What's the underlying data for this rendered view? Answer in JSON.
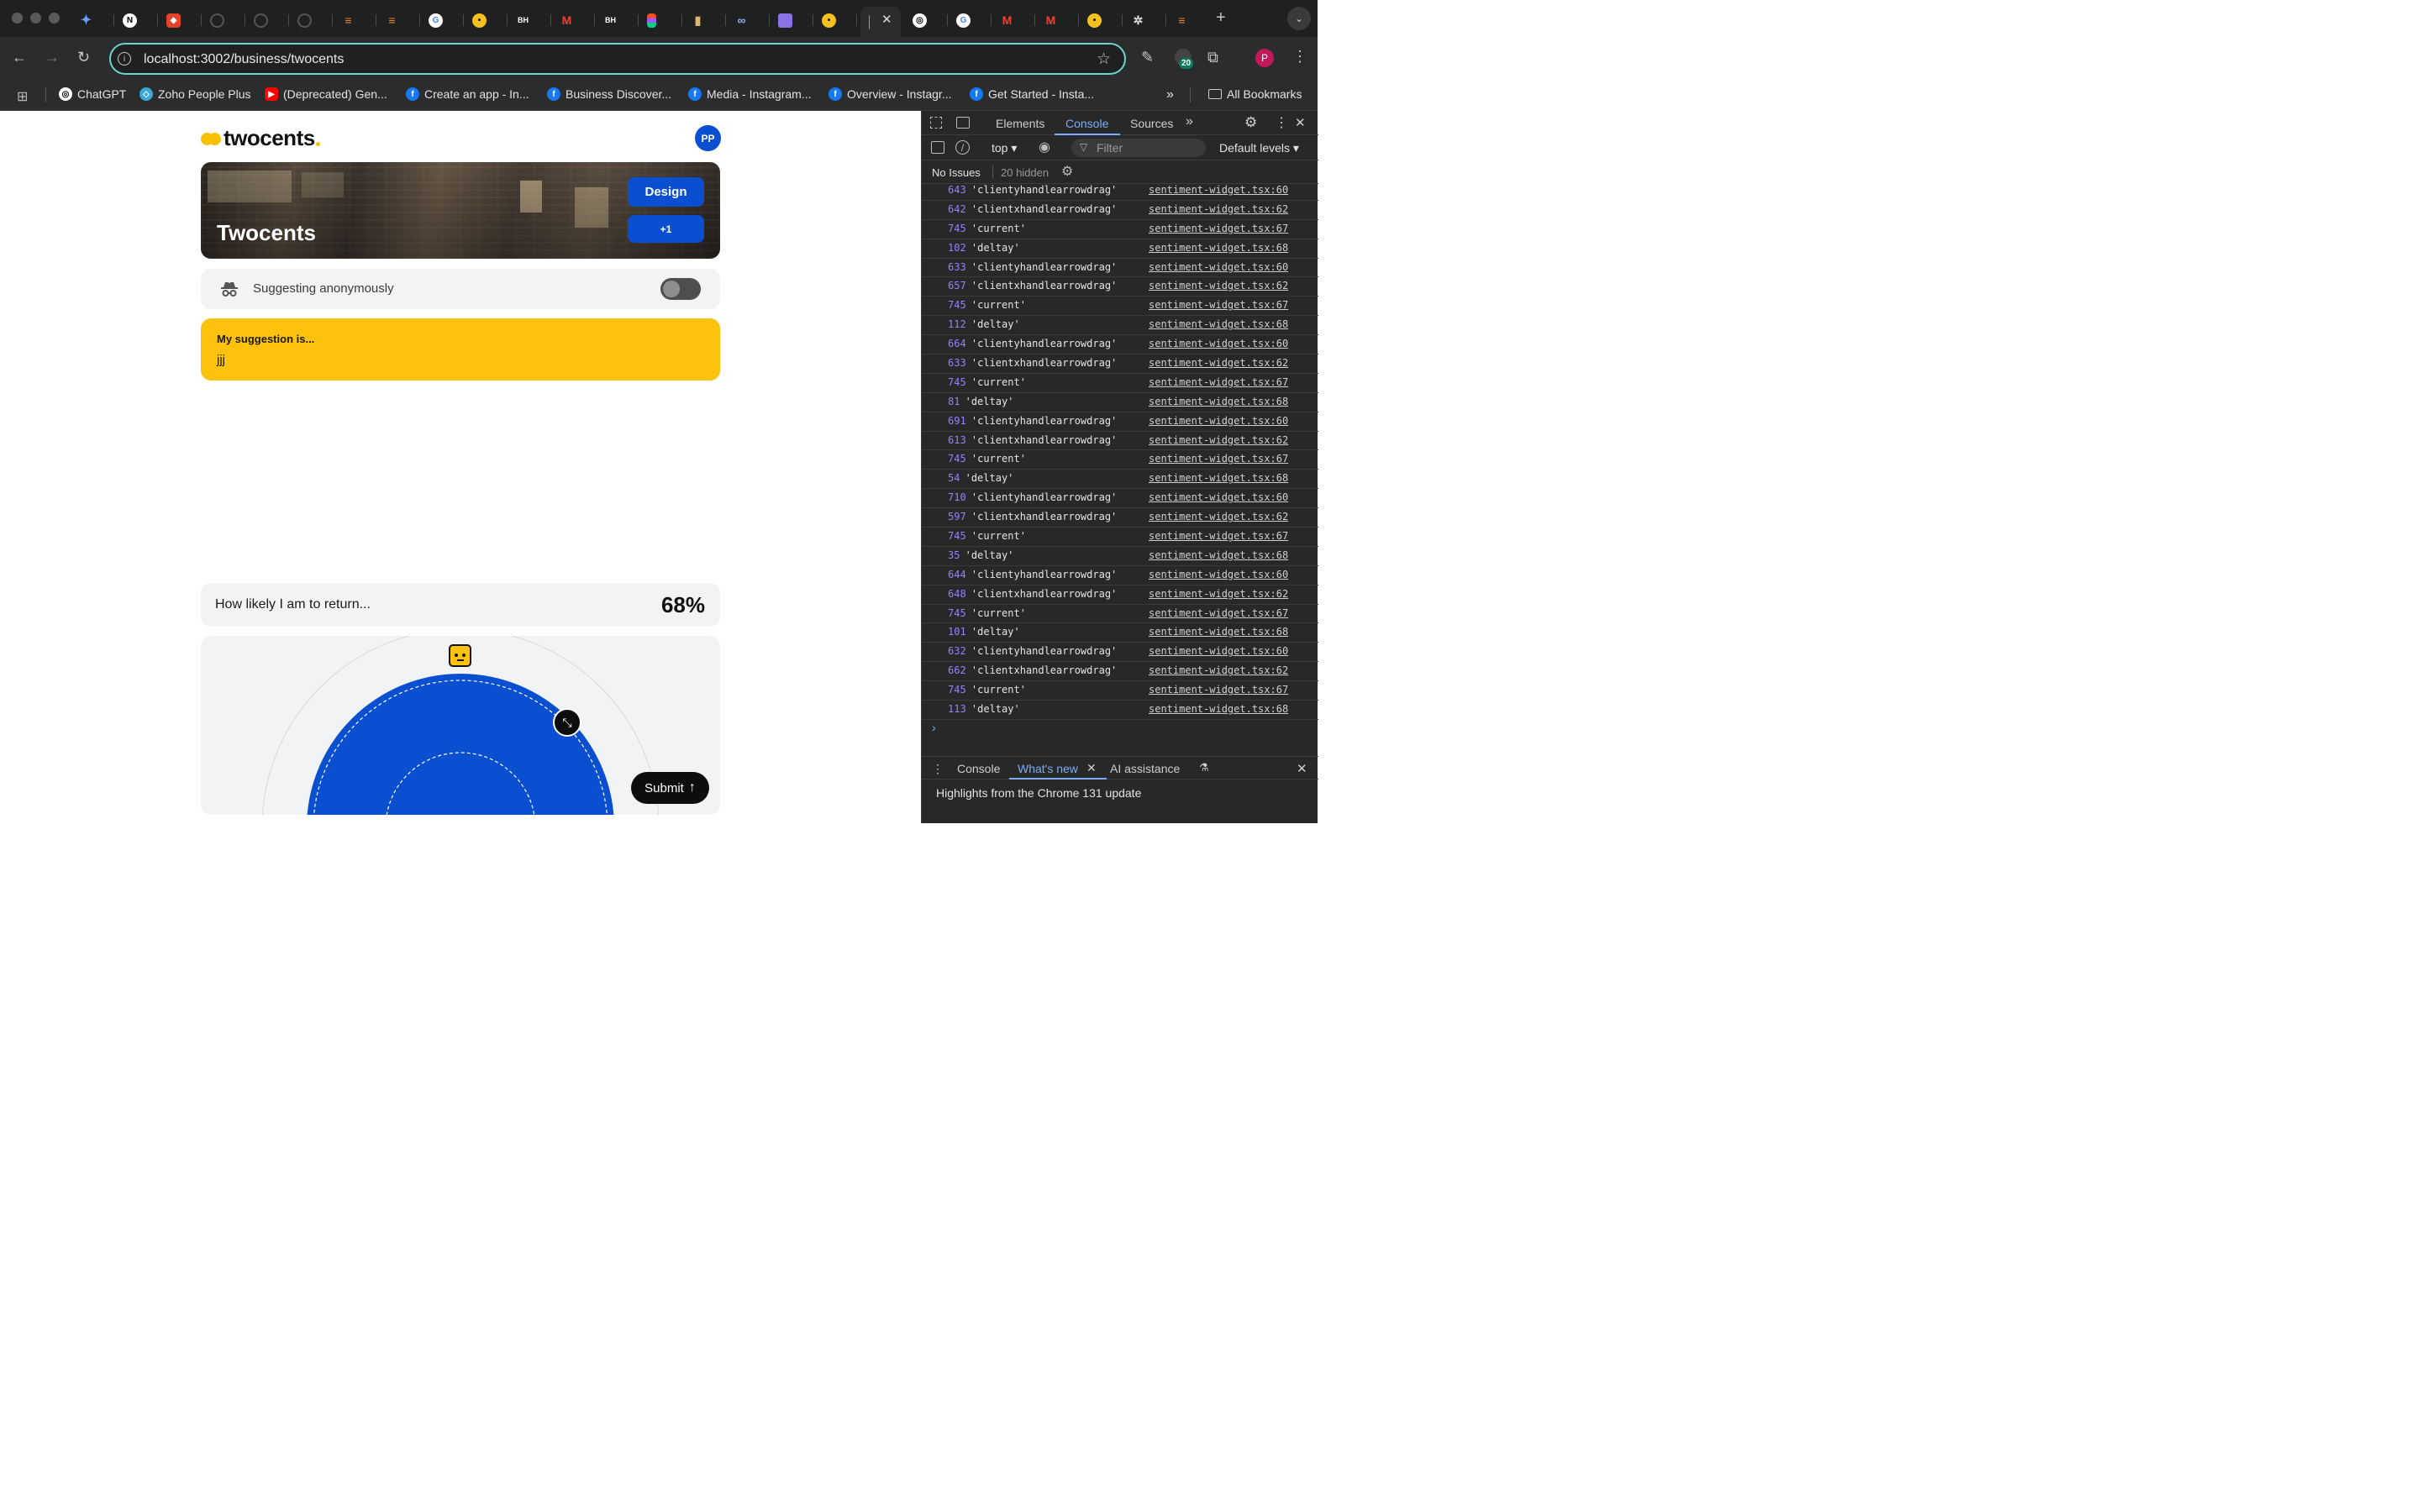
{
  "browser": {
    "url": "localhost:3002/business/twocents",
    "extension_badge": "20",
    "profile_initial": "P",
    "bookmarks": [
      {
        "label": "ChatGPT",
        "icon": "chatgpt-icon"
      },
      {
        "label": "Zoho People Plus",
        "icon": "zoho-icon"
      },
      {
        "label": "(Deprecated) Gen...",
        "icon": "youtube-icon"
      },
      {
        "label": "Create an app - In...",
        "icon": "facebook-icon"
      },
      {
        "label": "Business Discover...",
        "icon": "facebook-icon"
      },
      {
        "label": "Media - Instagram...",
        "icon": "facebook-icon"
      },
      {
        "label": "Overview - Instagr...",
        "icon": "facebook-icon"
      },
      {
        "label": "Get Started - Insta...",
        "icon": "facebook-icon"
      }
    ],
    "all_bookmarks": "All Bookmarks",
    "overflow": "»"
  },
  "page": {
    "logo_text": "twocents",
    "avatar_initials": "PP",
    "hero_title": "Twocents",
    "hero_tags": [
      "Design",
      "+1"
    ],
    "anonymous_label": "Suggesting anonymously",
    "anonymous_on": false,
    "suggestion_label": "My suggestion is...",
    "suggestion_value": "jjj",
    "likely_label": "How likely I am to return...",
    "likely_percent": "68%",
    "submit_label": "Submit",
    "colors": {
      "brand_yellow": "#fcc20d",
      "brand_blue": "#0a4fcf"
    }
  },
  "devtools": {
    "tabs": [
      "Elements",
      "Console",
      "Sources"
    ],
    "active_tab": "Console",
    "context": "top",
    "filter_placeholder": "Filter",
    "levels": "Default levels",
    "issues": "No Issues",
    "hidden": "20 hidden",
    "logs": [
      {
        "num": "643",
        "text": "'clientyhandlearrowdrag'",
        "src": "sentiment-widget.tsx:60"
      },
      {
        "num": "642",
        "text": "'clientxhandlearrowdrag'",
        "src": "sentiment-widget.tsx:62"
      },
      {
        "num": "745",
        "text": "'current'",
        "src": "sentiment-widget.tsx:67"
      },
      {
        "num": "102",
        "text": "'deltay'",
        "src": "sentiment-widget.tsx:68"
      },
      {
        "num": "633",
        "text": "'clientyhandlearrowdrag'",
        "src": "sentiment-widget.tsx:60"
      },
      {
        "num": "657",
        "text": "'clientxhandlearrowdrag'",
        "src": "sentiment-widget.tsx:62"
      },
      {
        "num": "745",
        "text": "'current'",
        "src": "sentiment-widget.tsx:67"
      },
      {
        "num": "112",
        "text": "'deltay'",
        "src": "sentiment-widget.tsx:68"
      },
      {
        "num": "664",
        "text": "'clientyhandlearrowdrag'",
        "src": "sentiment-widget.tsx:60"
      },
      {
        "num": "633",
        "text": "'clientxhandlearrowdrag'",
        "src": "sentiment-widget.tsx:62"
      },
      {
        "num": "745",
        "text": "'current'",
        "src": "sentiment-widget.tsx:67"
      },
      {
        "num": "81",
        "text": "'deltay'",
        "src": "sentiment-widget.tsx:68"
      },
      {
        "num": "691",
        "text": "'clientyhandlearrowdrag'",
        "src": "sentiment-widget.tsx:60"
      },
      {
        "num": "613",
        "text": "'clientxhandlearrowdrag'",
        "src": "sentiment-widget.tsx:62"
      },
      {
        "num": "745",
        "text": "'current'",
        "src": "sentiment-widget.tsx:67"
      },
      {
        "num": "54",
        "text": "'deltay'",
        "src": "sentiment-widget.tsx:68"
      },
      {
        "num": "710",
        "text": "'clientyhandlearrowdrag'",
        "src": "sentiment-widget.tsx:60"
      },
      {
        "num": "597",
        "text": "'clientxhandlearrowdrag'",
        "src": "sentiment-widget.tsx:62"
      },
      {
        "num": "745",
        "text": "'current'",
        "src": "sentiment-widget.tsx:67"
      },
      {
        "num": "35",
        "text": "'deltay'",
        "src": "sentiment-widget.tsx:68"
      },
      {
        "num": "644",
        "text": "'clientyhandlearrowdrag'",
        "src": "sentiment-widget.tsx:60"
      },
      {
        "num": "648",
        "text": "'clientxhandlearrowdrag'",
        "src": "sentiment-widget.tsx:62"
      },
      {
        "num": "745",
        "text": "'current'",
        "src": "sentiment-widget.tsx:67"
      },
      {
        "num": "101",
        "text": "'deltay'",
        "src": "sentiment-widget.tsx:68"
      },
      {
        "num": "632",
        "text": "'clientyhandlearrowdrag'",
        "src": "sentiment-widget.tsx:60"
      },
      {
        "num": "662",
        "text": "'clientxhandlearrowdrag'",
        "src": "sentiment-widget.tsx:62"
      },
      {
        "num": "745",
        "text": "'current'",
        "src": "sentiment-widget.tsx:67"
      },
      {
        "num": "113",
        "text": "'deltay'",
        "src": "sentiment-widget.tsx:68"
      }
    ],
    "drawer_tabs": [
      "Console",
      "What's new",
      "AI assistance"
    ],
    "drawer_active": "What's new",
    "drawer_message": "Highlights from the Chrome 131 update"
  }
}
